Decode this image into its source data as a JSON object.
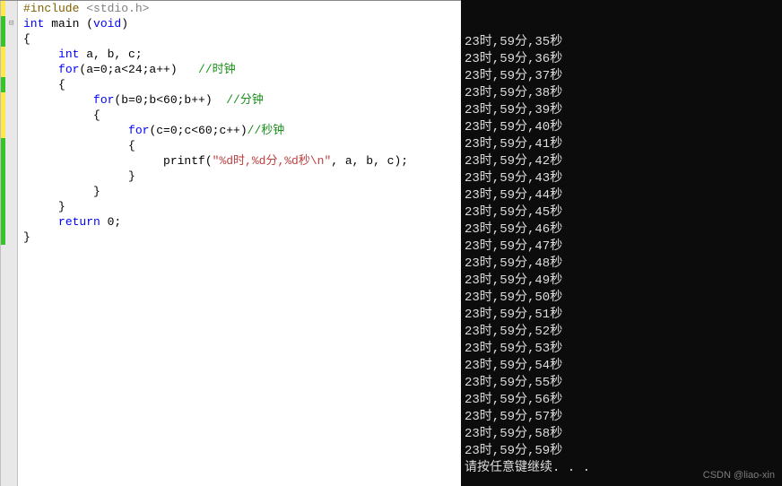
{
  "editor": {
    "lines": [
      {
        "indent": 0,
        "tokens": [
          [
            "pre",
            "#include"
          ],
          [
            "",
            ""
          ],
          [
            "inc",
            " <stdio.h>"
          ]
        ],
        "bar": "yellow",
        "collapse": ""
      },
      {
        "indent": 0,
        "tokens": [
          [
            "kw",
            "int"
          ],
          [
            "",
            " main ("
          ],
          [
            "kw",
            "void"
          ],
          [
            "",
            ")"
          ]
        ],
        "bar": "green",
        "collapse": "⊟"
      },
      {
        "indent": 0,
        "tokens": [
          [
            "",
            "{"
          ]
        ],
        "bar": "green",
        "collapse": ""
      },
      {
        "indent": 1,
        "tokens": [
          [
            "kw",
            "int"
          ],
          [
            "",
            " a, b, c;"
          ]
        ],
        "bar": "yellow",
        "collapse": ""
      },
      {
        "indent": 1,
        "tokens": [
          [
            "kw",
            "for"
          ],
          [
            "",
            "(a=0;a<24;a++)   "
          ],
          [
            "cmt",
            "//时钟"
          ]
        ],
        "bar": "yellow",
        "collapse": ""
      },
      {
        "indent": 1,
        "tokens": [
          [
            "",
            "{  "
          ]
        ],
        "bar": "green",
        "collapse": ""
      },
      {
        "indent": 2,
        "tokens": [
          [
            "kw",
            "for"
          ],
          [
            "",
            "(b=0;b<60;b++)  "
          ],
          [
            "cmt",
            "//分钟"
          ]
        ],
        "bar": "yellow",
        "collapse": ""
      },
      {
        "indent": 2,
        "tokens": [
          [
            "",
            "{"
          ]
        ],
        "bar": "yellow",
        "collapse": ""
      },
      {
        "indent": 3,
        "tokens": [
          [
            "kw",
            "for"
          ],
          [
            "",
            "(c=0;c<60;c++)"
          ],
          [
            "cmt",
            "//秒钟"
          ]
        ],
        "bar": "yellow",
        "collapse": ""
      },
      {
        "indent": 3,
        "tokens": [
          [
            "",
            "{"
          ]
        ],
        "bar": "green",
        "collapse": ""
      },
      {
        "indent": 4,
        "tokens": [
          [
            "",
            "printf("
          ],
          [
            "str",
            "\"%d时,%d分,%d秒\\n\""
          ],
          [
            "",
            ", a, b, c);"
          ]
        ],
        "bar": "green",
        "collapse": ""
      },
      {
        "indent": 3,
        "tokens": [
          [
            "",
            "}"
          ]
        ],
        "bar": "green",
        "collapse": ""
      },
      {
        "indent": 2,
        "tokens": [
          [
            "",
            "}"
          ]
        ],
        "bar": "green",
        "collapse": ""
      },
      {
        "indent": 1,
        "tokens": [
          [
            "",
            "}"
          ]
        ],
        "bar": "green",
        "collapse": ""
      },
      {
        "indent": 1,
        "tokens": [
          [
            "kw",
            "return"
          ],
          [
            "",
            " 0;"
          ]
        ],
        "bar": "green",
        "collapse": ""
      },
      {
        "indent": 0,
        "tokens": [
          [
            "",
            "}"
          ]
        ],
        "bar": "green",
        "collapse": ""
      }
    ]
  },
  "console": {
    "hour": 23,
    "minute": 59,
    "sec_start": 35,
    "sec_end": 59,
    "line_template": "{h}时,{m}分,{s}秒",
    "prompt": "请按任意键继续. . ."
  },
  "watermark": "CSDN @liao-xin"
}
